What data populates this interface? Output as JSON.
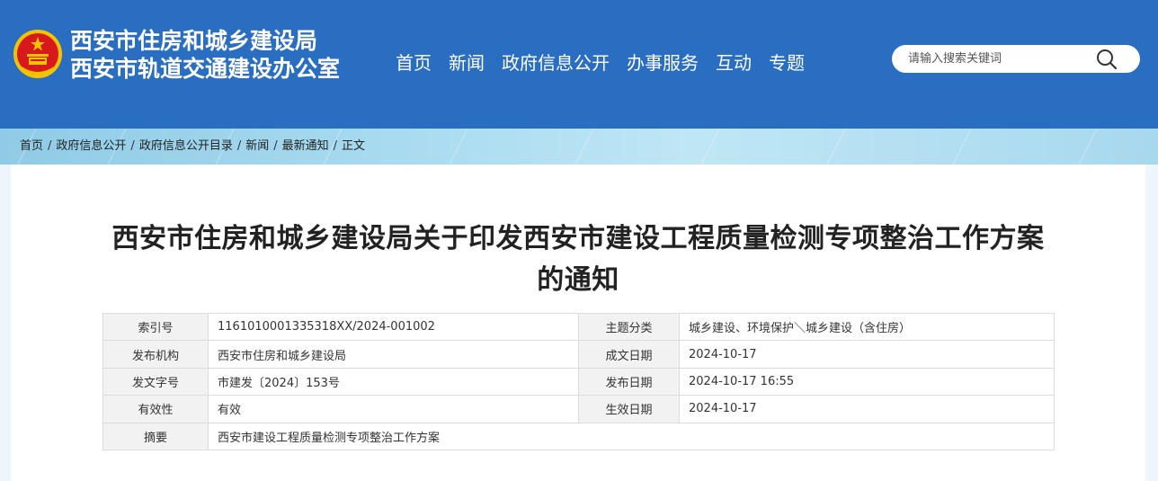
{
  "header": {
    "site_name_line1": "西安市住房和城乡建设局",
    "site_name_line2": "西安市轨道交通建设办公室",
    "nav": [
      "首页",
      "新闻",
      "政府信息公开",
      "办事服务",
      "互动",
      "专题"
    ],
    "search_placeholder": "请输入搜索关键词",
    "colors": {
      "header_bg": "#2a6ec2",
      "emblem_red": "#d7191c",
      "emblem_gold": "#f5c400"
    }
  },
  "breadcrumb": [
    "首页",
    "政府信息公开",
    "政府信息公开目录",
    "新闻",
    "最新通知",
    "正文"
  ],
  "breadcrumb_separator": "/",
  "article": {
    "title_line1": "西安市住房和城乡建设局关于印发西安市建设工程质量检测专项整治工作方案",
    "title_line2": "的通知"
  },
  "meta": {
    "rows": [
      {
        "l1": "索引号",
        "v1": "1161010001335318XX/2024-001002",
        "l2": "主题分类",
        "v2": "城乡建设、环境保护＼城乡建设（含住房）"
      },
      {
        "l1": "发布机构",
        "v1": "西安市住房和城乡建设局",
        "l2": "成文日期",
        "v2": "2024-10-17"
      },
      {
        "l1": "发文字号",
        "v1": "市建发〔2024〕153号",
        "l2": "发布日期",
        "v2": "2024-10-17 16:55"
      },
      {
        "l1": "有效性",
        "v1": "有效",
        "l2": "生效日期",
        "v2": "2024-10-17"
      }
    ],
    "summary_label": "摘要",
    "summary_value": "西安市建设工程质量检测专项整治工作方案"
  }
}
